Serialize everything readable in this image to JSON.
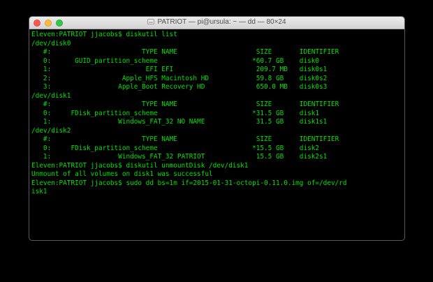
{
  "window": {
    "title": "PATRIOT — pi@ursula: ~ — dd — 80×24",
    "drive_icon": "external-drive-icon",
    "text_color": "#00e000",
    "background_color": "#000000"
  },
  "terminal": {
    "lines": [
      "Eleven:PATRIOT jjacobs$ diskutil list",
      "/dev/disk0",
      "   #:                       TYPE NAME                    SIZE       IDENTIFIER",
      "   0:      GUID_partition_scheme                        *60.7 GB    disk0",
      "   1:                        EFI EFI                     209.7 MB   disk0s1",
      "   2:                  Apple_HFS Macintosh HD            59.8 GB    disk0s2",
      "   3:                 Apple_Boot Recovery HD             650.0 MB   disk0s3",
      "/dev/disk1",
      "   #:                       TYPE NAME                    SIZE       IDENTIFIER",
      "   0:     FDisk_partition_scheme                        *31.5 GB    disk1",
      "   1:                 Windows_FAT_32 NO NAME             31.5 GB    disk1s1",
      "/dev/disk2",
      "   #:                       TYPE NAME                    SIZE       IDENTIFIER",
      "   0:     FDisk_partition_scheme                        *15.5 GB    disk2",
      "   1:                 Windows_FAT_32 PATRIOT             15.5 GB    disk2s1",
      "Eleven:PATRIOT jjacobs$ diskutil unmountDisk /dev/disk1",
      "Unmount of all volumes on disk1 was successful",
      "Eleven:PATRIOT jjacobs$ sudo dd bs=1m if=2015-01-31-octopi-0.11.0.img of=/dev/rd",
      "isk1"
    ]
  }
}
